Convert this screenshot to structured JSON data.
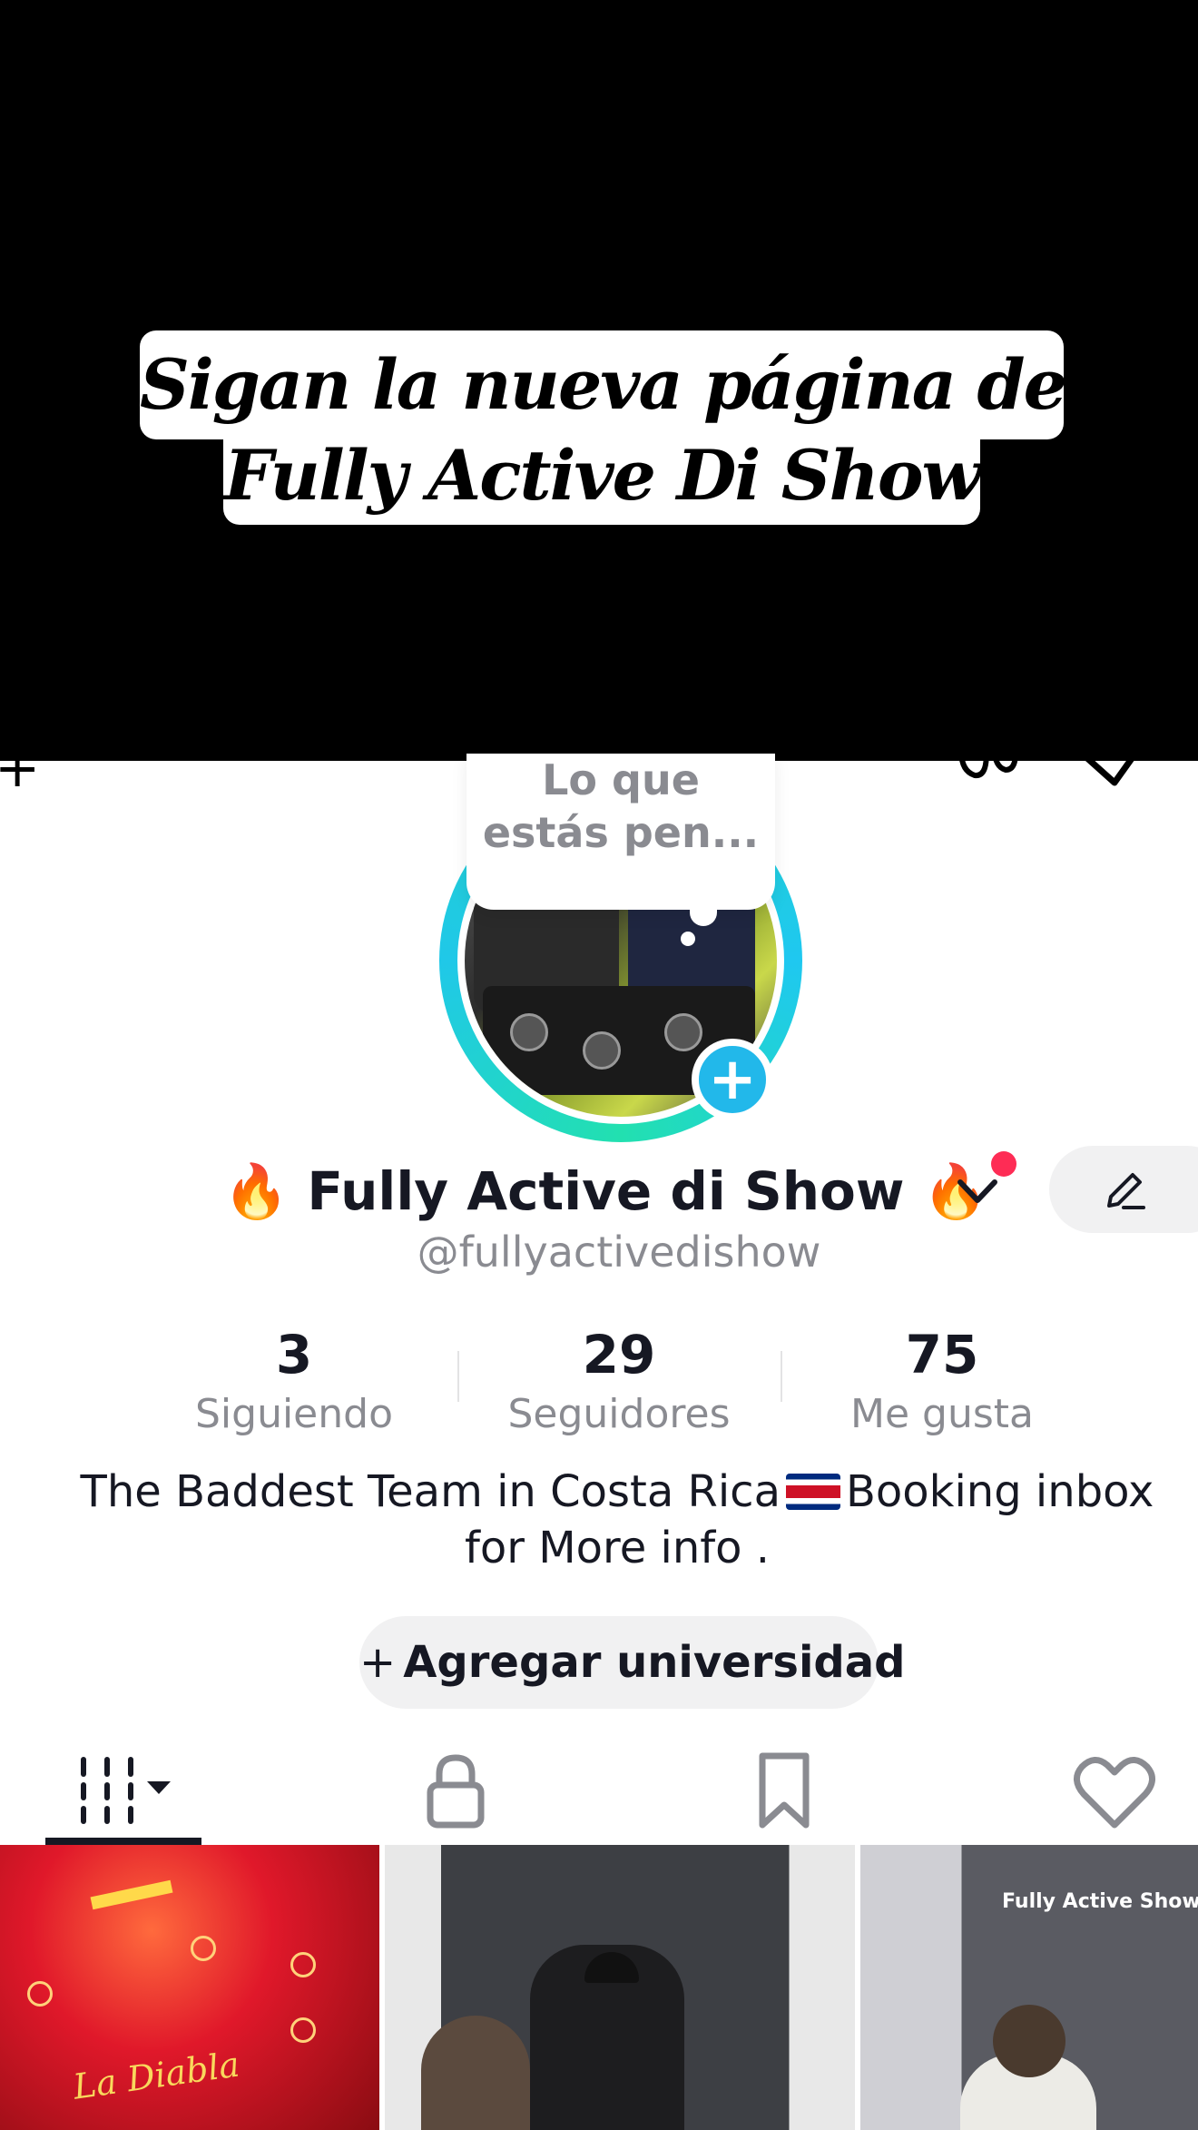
{
  "banner": {
    "line1": "Sigan la nueva página de",
    "line2": "Fully Active Di Show"
  },
  "bubble": {
    "line1": "Lo que",
    "line2": "estás pen..."
  },
  "profile": {
    "display_name": "🔥 Fully Active di Show 🔥",
    "handle": "@fullyactivedishow"
  },
  "stats": {
    "following": {
      "value": "3",
      "label": "Siguiendo"
    },
    "followers": {
      "value": "29",
      "label": "Seguidores"
    },
    "likes": {
      "value": "75",
      "label": "Me gusta"
    }
  },
  "bio": {
    "before_flag": "The Baddest Team in Costa Rica",
    "after_flag": "Booking inbox",
    "line2": "for More info ."
  },
  "university_button": {
    "plus": "+",
    "label": "Agregar universidad"
  },
  "thumbnails": {
    "thumb1_text": "La Diabla",
    "thumb3_text": "Fully Active Show 🔏👽"
  },
  "colors": {
    "accent_blue": "#22b8ea",
    "notification_red": "#fe2c55",
    "ring_teal": "#22d3c5"
  },
  "icons": [
    "plus-icon",
    "chevron-down-icon",
    "pencil-icon",
    "grid-icon",
    "lock-icon",
    "bookmark-icon",
    "heart-icon"
  ]
}
